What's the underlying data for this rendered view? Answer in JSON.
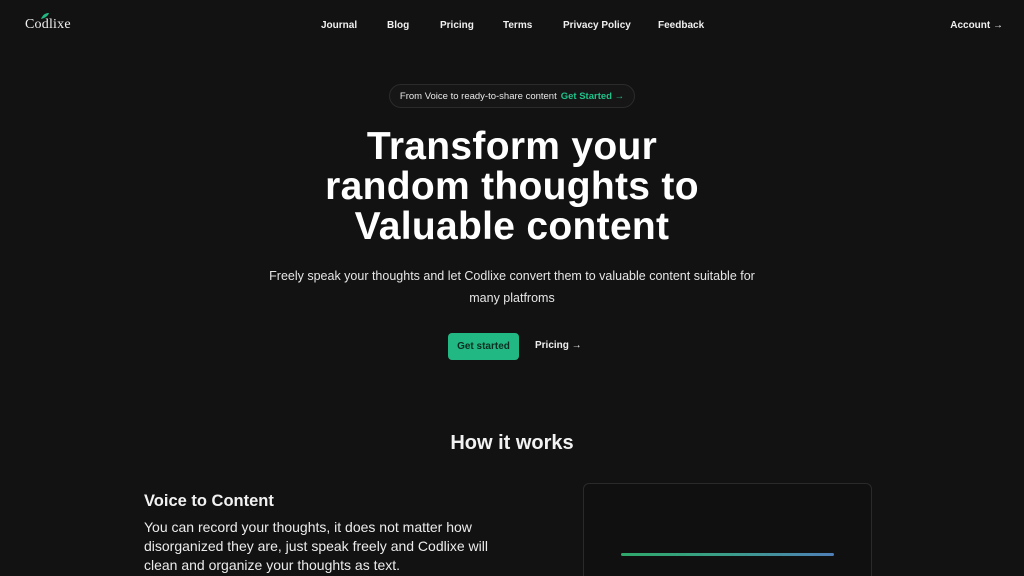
{
  "header": {
    "logo_text": "Codlixe",
    "nav": [
      {
        "label": "Journal"
      },
      {
        "label": "Blog"
      },
      {
        "label": "Pricing"
      },
      {
        "label": "Terms"
      },
      {
        "label": "Privacy Policy"
      },
      {
        "label": "Feedback"
      }
    ],
    "account_label": "Account →"
  },
  "hero": {
    "pill_text": "From Voice to ready-to-share content",
    "pill_cta": "Get Started →",
    "title_line1": "Transform your",
    "title_line2": "random thoughts to",
    "title_line3": "Valuable content",
    "subtitle": "Freely speak your thoughts and let Codlixe convert them to valuable content suitable for many platfroms",
    "primary_button": "Get started",
    "secondary_link": "Pricing →"
  },
  "how_it_works": {
    "title": "How it works",
    "feature_title": "Voice to Content",
    "feature_description": "You can record your thoughts, it does not matter how disorganized they are, just speak freely and Codlixe will clean and organize your thoughts as text."
  },
  "colors": {
    "background": "#121212",
    "accent": "#22b883",
    "accent_text": "#1fc38a"
  }
}
